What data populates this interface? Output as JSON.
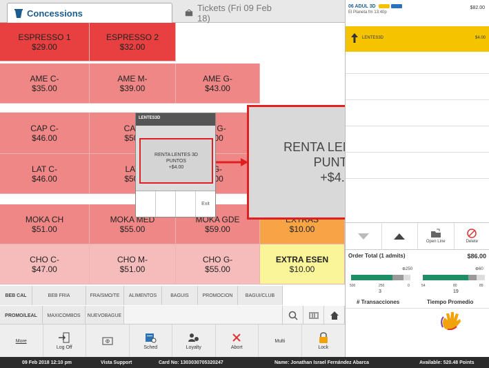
{
  "tabs": {
    "concessions": "Concessions",
    "tickets": "Tickets (Fri 09 Feb 18)"
  },
  "tiles": {
    "espresso1": {
      "name": "ESPRESSO 1",
      "price": "$29.00"
    },
    "espresso2": {
      "name": "ESPRESSO 2",
      "price": "$32.00"
    },
    "ame_c": {
      "name": "AME C-",
      "price": "$35.00"
    },
    "ame_m": {
      "name": "AME M-",
      "price": "$39.00"
    },
    "ame_g": {
      "name": "AME G-",
      "price": "$43.00"
    },
    "cap_c": {
      "name": "CAP C-",
      "price": "$46.00"
    },
    "cap_m": {
      "name": "CAP",
      "price": "$50."
    },
    "cap_g": {
      "name": "P G-",
      "price": ".00"
    },
    "lat_c": {
      "name": "LAT C-",
      "price": "$46.00"
    },
    "lat_m": {
      "name": "LAT",
      "price": "$50."
    },
    "lat_g": {
      "name": "G-",
      "price": ".00"
    },
    "moka_ch": {
      "name": "MOKA CH",
      "price": "$51.00"
    },
    "moka_med": {
      "name": "MOKA MED",
      "price": "$55.00"
    },
    "moka_gde": {
      "name": "MOKA GDE",
      "price": "$59.00"
    },
    "extras": {
      "name": "EXTRAS",
      "price": "$10.00"
    },
    "cho_c": {
      "name": "CHO C-",
      "price": "$47.00"
    },
    "cho_m": {
      "name": "CHO M-",
      "price": "$51.00"
    },
    "cho_g": {
      "name": "CHO G-",
      "price": "$55.00"
    },
    "extra_esen": {
      "name": "EXTRA ESEN",
      "price": "$10.00"
    }
  },
  "categories_row1": [
    "BEB CAL",
    "BEB FRIA",
    "FRA/SMO/TE",
    "ALIMENTOS",
    "BAGUIS",
    "PROMOCION",
    "BAGUI/CLUB"
  ],
  "categories_row2": [
    "PROMO/LEAL",
    "MAXICOMBOS",
    "NUEVOBAGUE"
  ],
  "toolbar": {
    "more": "More",
    "logoff": "Log Off",
    "sched": "Sched",
    "loyalty": "Loyalty",
    "abort": "Abort",
    "multi": "Multi",
    "lock": "Lock"
  },
  "popup": {
    "header": "LENTES3D",
    "item_line1": "RENTA LENTES 3D",
    "item_line2": "PUNTOS",
    "item_price": "+$4.00",
    "exit": "Exit"
  },
  "zoom": {
    "line1": "RENTA LENTES 3D",
    "line2": "PUNTOS",
    "line3": "+$4.00"
  },
  "order": {
    "item_title": "06 ADUL 3D",
    "item_subtitle": "El Planeta fm 13:40p",
    "item_price": "$82.00",
    "sub_item": "LENTES3D",
    "sub_price": "$4.00",
    "open_line": "Open Line",
    "delete": "Delete",
    "total_label": "Order Total (1 admits)",
    "total_value": "$86.00",
    "gauge1_marker": "250",
    "gauge2_marker": "60",
    "gauge1_ticks": [
      "500",
      "250",
      "0"
    ],
    "gauge2_ticks": [
      "54",
      "80",
      "89"
    ],
    "gauge1_value": "3",
    "gauge2_value": "19",
    "transacciones": "# Transacciones",
    "tiempo": "Tiempo Promedio"
  },
  "status": {
    "datetime": "09 Feb 2018 12:10 pm",
    "user": "Vista Support",
    "card": "Card No: 1303030705320247",
    "name": "Name: Jonathan Israel Fernández Abarca",
    "available": "Available: 520.48 Points"
  },
  "colors": {
    "red": "#e84040",
    "pink": "#f08787",
    "lightpink": "#f6bcbc",
    "orange": "#f7a447",
    "yellow": "#fbf59a",
    "selected": "#f5c400",
    "highlight": "#e02020"
  }
}
